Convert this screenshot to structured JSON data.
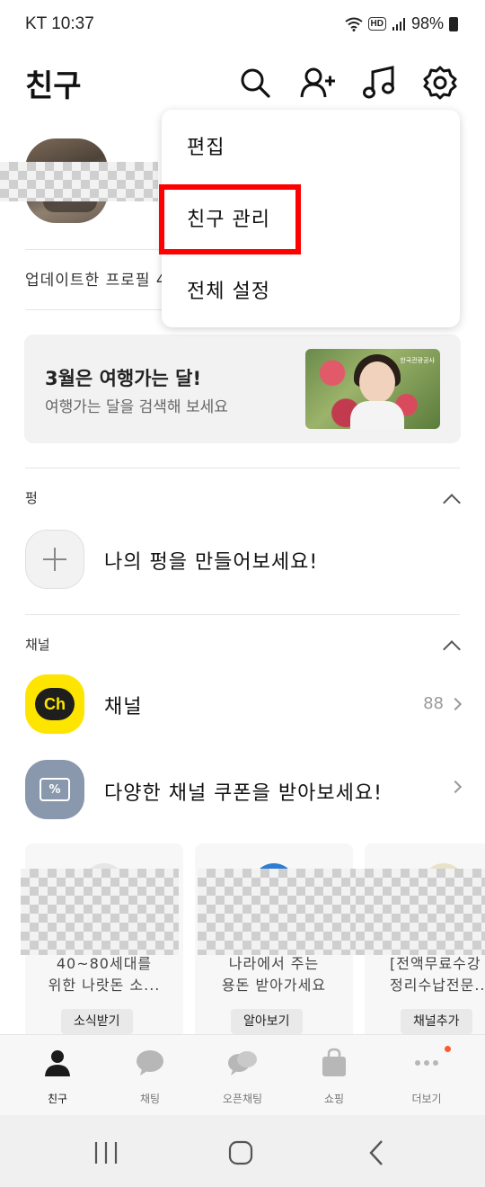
{
  "status_bar": {
    "carrier_time": "KT 10:37",
    "hd": "HD",
    "battery": "98%"
  },
  "header": {
    "title": "친구",
    "icons": [
      "search-icon",
      "add-friend-icon",
      "music-icon",
      "settings-icon"
    ]
  },
  "profile": {
    "updated_text": "업데이트한 프로필 4"
  },
  "dropdown_menu": {
    "items": [
      "편집",
      "친구 관리",
      "전체 설정"
    ],
    "highlighted": "친구 관리"
  },
  "banner": {
    "title": "3월은 여행가는 달!",
    "subtitle": "여행가는 달을 검색해 보세요",
    "image_tag": "한국관광공사"
  },
  "pung": {
    "label": "펑",
    "create_text": "나의 펑을 만들어보세요!"
  },
  "channels": {
    "label": "채널",
    "channel_row": {
      "label": "채널",
      "badge": "88"
    },
    "coupon_row": {
      "label": "다양한 채널 쿠폰을 받아보세요!"
    },
    "cards": [
      {
        "text_line1": "40~80세대를",
        "text_line2": "위한 나랏돈 소...",
        "button": "소식받기"
      },
      {
        "text_line1": "나라에서 주는",
        "text_line2": "용돈 받아가세요",
        "button": "알아보기"
      },
      {
        "text_line1": "[전액무료수강",
        "text_line2": "정리수납전문...",
        "button": "채널추가"
      }
    ]
  },
  "tabbar": {
    "tabs": [
      {
        "label": "친구",
        "icon": "person-icon",
        "active": true
      },
      {
        "label": "채팅",
        "icon": "chat-bubble-icon",
        "active": false
      },
      {
        "label": "오픈채팅",
        "icon": "open-chat-icon",
        "active": false
      },
      {
        "label": "쇼핑",
        "icon": "shopping-bag-icon",
        "active": false
      },
      {
        "label": "더보기",
        "icon": "more-icon",
        "active": false
      }
    ]
  },
  "colors": {
    "kakao_yellow": "#FEE500",
    "highlight_red": "#FF0000",
    "notification_dot": "#FF5A2D"
  }
}
